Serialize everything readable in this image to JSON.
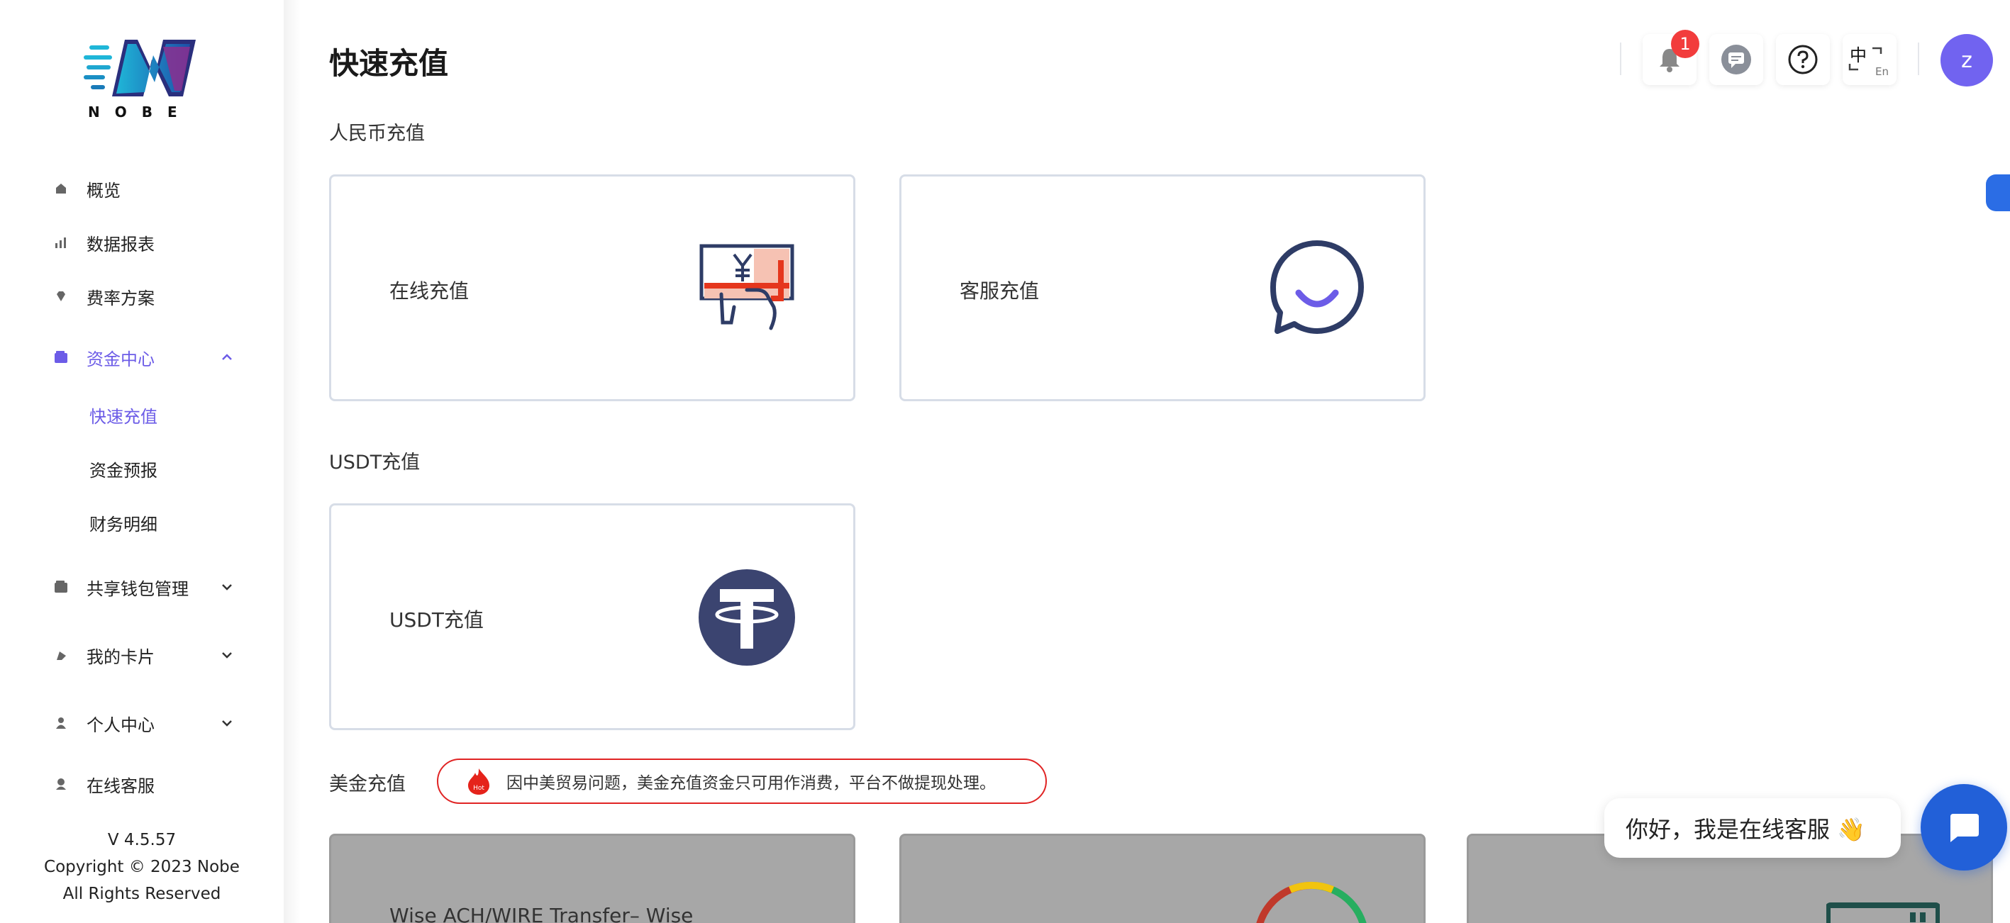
{
  "app": {
    "logo_text": "NOBE",
    "accent": "#6c5ce7"
  },
  "sidebar": {
    "items": [
      {
        "label": "概览",
        "icon": "home-icon"
      },
      {
        "label": "数据报表",
        "icon": "chart-icon"
      },
      {
        "label": "费率方案",
        "icon": "diamond-icon"
      },
      {
        "label": "资金中心",
        "icon": "wallet-icon",
        "expanded": true
      },
      {
        "label": "共享钱包管理",
        "icon": "wallet-icon"
      },
      {
        "label": "我的卡片",
        "icon": "card-icon"
      },
      {
        "label": "个人中心",
        "icon": "user-icon"
      },
      {
        "label": "在线客服",
        "icon": "support-icon"
      }
    ],
    "sub_items": [
      "快速充值",
      "资金预报",
      "财务明细"
    ],
    "version": "V 4.5.57",
    "copyright": "Copyright © 2023 Nobe",
    "rights": "All Rights Reserved"
  },
  "header": {
    "title": "快速充值",
    "notification_count": "1",
    "language_primary": "中",
    "language_secondary": "En",
    "avatar_letter": "z"
  },
  "sections": {
    "rmb": {
      "title": "人民币充值",
      "cards": [
        "在线充值",
        "客服充值"
      ]
    },
    "usdt": {
      "title": "USDT充值",
      "cards": [
        "USDT充值"
      ]
    },
    "usd": {
      "title": "美金充值",
      "notice": "因中美贸易问题，美金充值资金只可用作消费，平台不做提现处理。",
      "hot_label": "Hot",
      "cards": [
        "Wise ACH/WIRE Transfer– Wise",
        "",
        ""
      ]
    }
  },
  "chat": {
    "greeting": "你好，我是在线客服 👋"
  }
}
